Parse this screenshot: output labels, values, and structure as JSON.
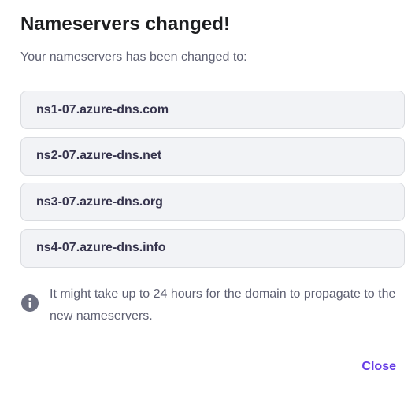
{
  "dialog": {
    "title": "Nameservers changed!",
    "subtitle": "Your nameservers has been changed to:",
    "nameservers": [
      "ns1-07.azure-dns.com",
      "ns2-07.azure-dns.net",
      "ns3-07.azure-dns.org",
      "ns4-07.azure-dns.info"
    ],
    "notice": {
      "icon": "info-icon",
      "text": "It might take up to 24 hours for the domain to propagate to the new nameservers."
    },
    "close_label": "Close"
  },
  "colors": {
    "accent": "#673de6",
    "icon": "#6d7081",
    "field_background": "#f2f3f6"
  }
}
